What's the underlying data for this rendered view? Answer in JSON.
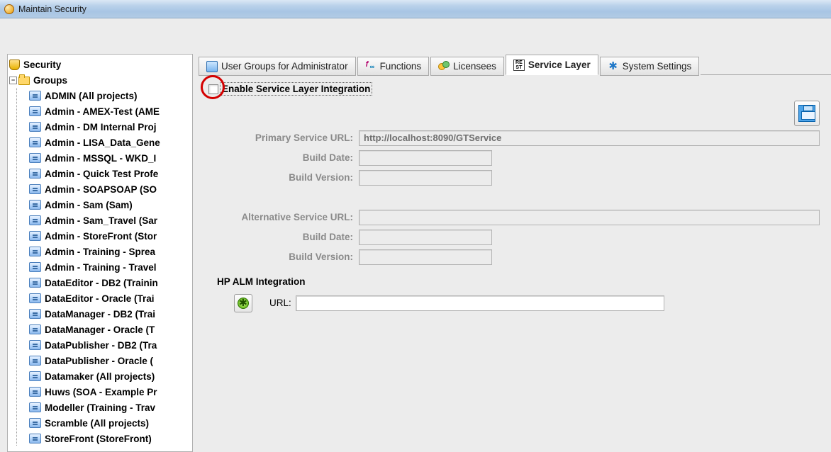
{
  "window": {
    "title": "Maintain Security"
  },
  "tree": {
    "root_label": "Security",
    "groups_label": "Groups",
    "items": [
      "ADMIN (All projects)",
      "Admin - AMEX-Test (AME",
      "Admin - DM Internal Proj",
      "Admin - LISA_Data_Gene",
      "Admin - MSSQL - WKD_I",
      "Admin - Quick Test Profe",
      "Admin - SOAPSOAP (SO",
      "Admin - Sam (Sam)",
      "Admin - Sam_Travel (Sar",
      "Admin - StoreFront (Stor",
      "Admin - Training - Sprea",
      "Admin - Training - Travel",
      "DataEditor - DB2 (Trainin",
      "DataEditor - Oracle (Trai",
      "DataManager - DB2 (Trai",
      "DataManager - Oracle (T",
      "DataPublisher - DB2 (Tra",
      "DataPublisher - Oracle (",
      "Datamaker (All projects)",
      "Huws (SOA - Example Pr",
      "Modeller (Training - Trav",
      "Scramble (All projects)",
      "StoreFront (StoreFront)"
    ]
  },
  "tabs": {
    "user_groups": "User Groups for Administrator",
    "functions": "Functions",
    "licensees": "Licensees",
    "service_layer": "Service Layer",
    "system_settings": "System Settings",
    "active": "service_layer"
  },
  "form": {
    "enable_label": "Enable Service Layer Integration",
    "primary_url_label": "Primary Service URL:",
    "primary_url_value": "http://localhost:8090/GTService",
    "build_date_label": "Build Date:",
    "build_date_value": "",
    "build_version_label": "Build Version:",
    "build_version_value": "",
    "alt_url_label": "Alternative Service URL:",
    "alt_url_value": "",
    "alt_build_date_value": "",
    "alt_build_version_value": "",
    "alm_heading": "HP ALM Integration",
    "alm_url_label": "URL:",
    "alm_url_value": ""
  },
  "icons": {
    "rest_text": "RE\nST"
  }
}
